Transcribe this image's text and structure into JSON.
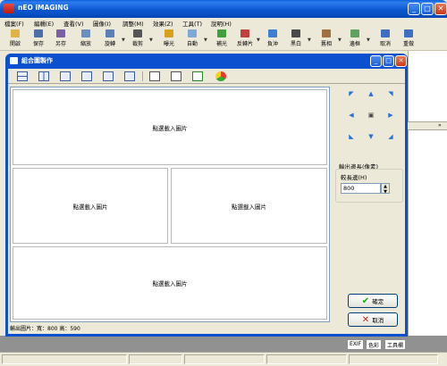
{
  "app": {
    "title": "nEO iMAGING",
    "menu": [
      "檔案(F)",
      "編輯(E)",
      "查看(V)",
      "圖像(I)",
      "調整(M)",
      "效果(Z)",
      "工具(T)",
      "說明(H)"
    ],
    "toolbar": [
      {
        "label": "開啟",
        "icon": "folder-open-icon",
        "color": "#e0b34a"
      },
      {
        "label": "保存",
        "icon": "save-icon",
        "color": "#4b6fa8"
      },
      {
        "label": "另存",
        "icon": "save-as-icon",
        "color": "#7a5fa8"
      },
      {
        "label": "縮放",
        "icon": "resize-icon",
        "color": "#6b8fc0"
      },
      {
        "label": "旋轉",
        "icon": "rotate-icon",
        "color": "#5b7fb8"
      },
      {
        "label": "裁剪",
        "icon": "crop-icon",
        "color": "#555555"
      },
      {
        "label": "曝光",
        "icon": "exposure-icon",
        "color": "#d8a020"
      },
      {
        "label": "自動",
        "icon": "auto-icon",
        "color": "#7fa8d8"
      },
      {
        "label": "補光",
        "icon": "fill-light-icon",
        "color": "#40a040"
      },
      {
        "label": "反轉片",
        "icon": "reversal-film-icon",
        "color": "#c04040"
      },
      {
        "label": "負沖",
        "icon": "cross-process-icon",
        "color": "#3f7fd0"
      },
      {
        "label": "黑白",
        "icon": "black-white-icon",
        "color": "#4a4a4a"
      },
      {
        "label": "舊相",
        "icon": "old-photo-icon",
        "color": "#a07040"
      },
      {
        "label": "邊框",
        "icon": "border-icon",
        "color": "#60a060"
      },
      {
        "label": "取消",
        "icon": "undo-icon",
        "color": "#3f6fc0"
      },
      {
        "label": "重做",
        "icon": "redo-icon",
        "color": "#3f6fc0"
      }
    ],
    "panel_tabs": [
      "EXIF",
      "色彩",
      "工具欄"
    ]
  },
  "dialog": {
    "title": "組合圖製作",
    "cells": [
      {
        "label": "點選載入圖片"
      },
      {
        "label": "點選載入圖片"
      },
      {
        "label": "點選載入圖片"
      },
      {
        "label": "點選載入圖片"
      }
    ],
    "output_info": "輸出圖片：寬：800 高：590",
    "size_section_label": "輸出邊長(像素)",
    "long_side_label": "較長邊(H)",
    "long_side_value": "800",
    "ok_label": "確定",
    "cancel_label": "取消"
  }
}
